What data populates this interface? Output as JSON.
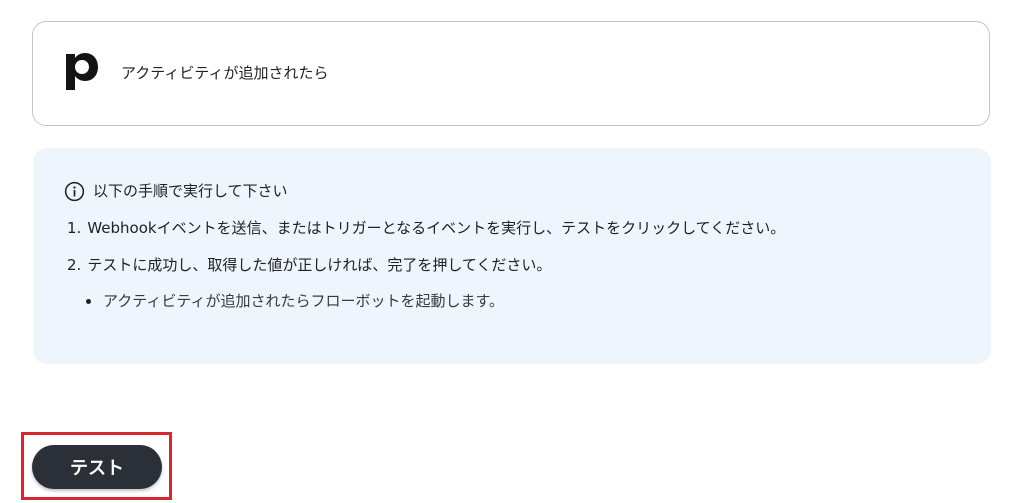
{
  "trigger": {
    "app_icon": "pipedrive-p-logo",
    "label": "アクティビティが追加されたら"
  },
  "instructions": {
    "icon": "info-circle-icon",
    "title": "以下の手順で実行して下さい",
    "steps": [
      {
        "number": "1.",
        "text": "Webhookイベントを送信、またはトリガーとなるイベントを実行し、テストをクリックしてください。"
      },
      {
        "number": "2.",
        "text": "テストに成功し、取得した値が正しければ、完了を押してください。"
      }
    ],
    "bullets": [
      "アクティビティが追加されたらフローボットを起動します。"
    ]
  },
  "actions": {
    "test_label": "テスト"
  },
  "colors": {
    "panel_bg": "#eef5fd",
    "button_bg": "#2a2f38",
    "highlight": "#d9262e"
  }
}
